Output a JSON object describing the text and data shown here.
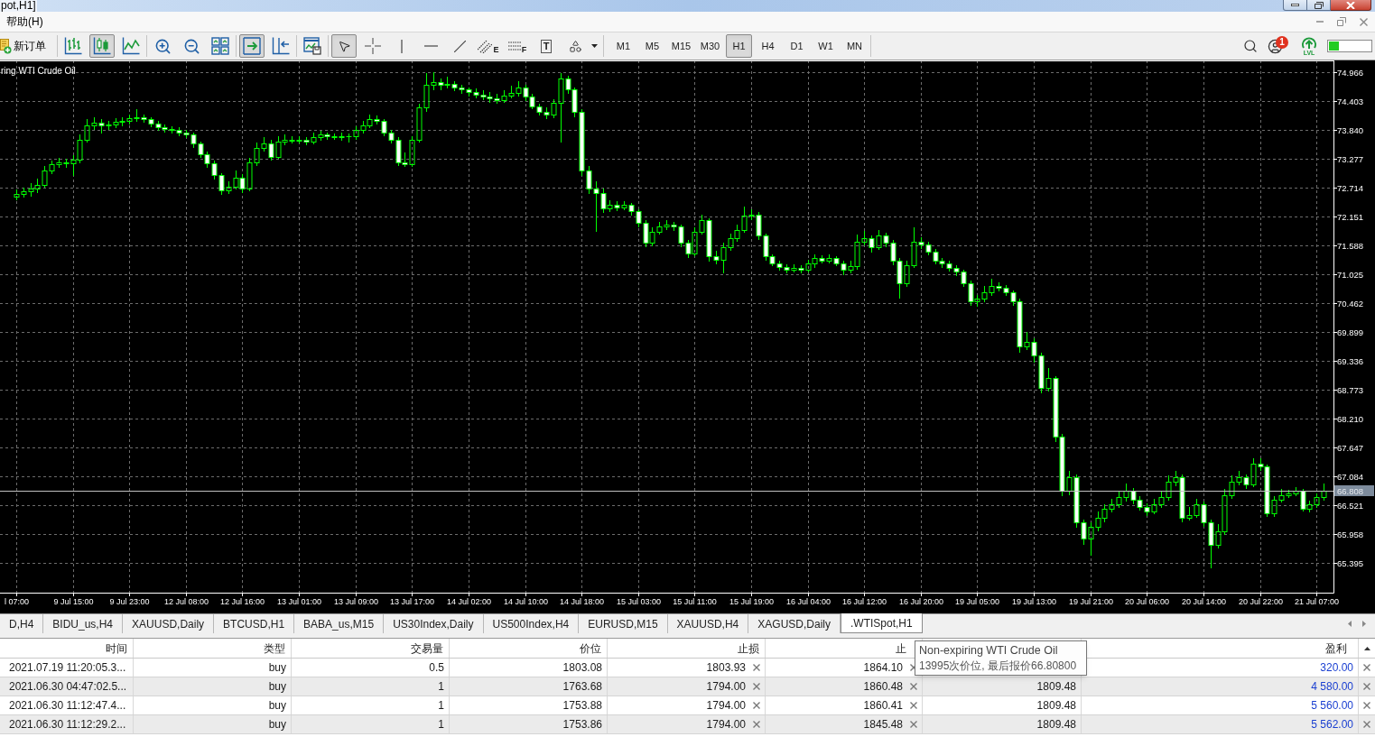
{
  "window": {
    "title": "pot,H1]"
  },
  "menu": {
    "items": [
      "帮助(H)"
    ]
  },
  "toolbar": {
    "new_order": "新订单",
    "chart_modes": [
      {
        "kind": "bars",
        "selected": false
      },
      {
        "kind": "candles",
        "selected": true
      },
      {
        "kind": "line",
        "selected": false
      }
    ],
    "chart_options": [
      {
        "kind": "auto_scroll",
        "on": true
      },
      {
        "kind": "chart_shift",
        "on": false
      }
    ],
    "tools": [
      {
        "kind": "cursor",
        "selected": true
      },
      {
        "kind": "crosshair",
        "selected": false
      },
      {
        "kind": "vertical_line",
        "selected": false
      },
      {
        "kind": "horizontal_line",
        "selected": false
      },
      {
        "kind": "trendline",
        "selected": false
      },
      {
        "kind": "fibonacci",
        "selected": false,
        "letter": "E"
      },
      {
        "kind": "levels",
        "selected": false,
        "letter": "F"
      },
      {
        "kind": "text",
        "selected": false,
        "letter": "T"
      },
      {
        "kind": "shapes",
        "selected": false
      }
    ],
    "timeframes": [
      {
        "label": "M1",
        "selected": false
      },
      {
        "label": "M5",
        "selected": false
      },
      {
        "label": "M15",
        "selected": false
      },
      {
        "label": "M30",
        "selected": false
      },
      {
        "label": "H1",
        "selected": true
      },
      {
        "label": "H4",
        "selected": false
      },
      {
        "label": "D1",
        "selected": false
      },
      {
        "label": "W1",
        "selected": false
      },
      {
        "label": "MN",
        "selected": false
      }
    ],
    "notifications": "1",
    "level_label": "LVL"
  },
  "chart": {
    "chart_data": [
      {
        "type": "candlestick",
        "title": "ring WTI Crude Oil",
        "color": "#00ff00",
        "grid": true,
        "ylim": [
          64.82,
          75.2
        ],
        "yticks": [
          {
            "value": 74.966,
            "label": "74.966"
          },
          {
            "value": 74.403,
            "label": "74.403"
          },
          {
            "value": 73.84,
            "label": "73.840"
          },
          {
            "value": 73.277,
            "label": "73.277"
          },
          {
            "value": 72.714,
            "label": "72.714"
          },
          {
            "value": 72.151,
            "label": "72.151"
          },
          {
            "value": 71.588,
            "label": "71.588"
          },
          {
            "value": 71.025,
            "label": "71.025"
          },
          {
            "value": 70.462,
            "label": "70.462"
          },
          {
            "value": 69.899,
            "label": "69.899"
          },
          {
            "value": 69.336,
            "label": "69.336"
          },
          {
            "value": 68.773,
            "label": "68.773"
          },
          {
            "value": 68.21,
            "label": "68.210"
          },
          {
            "value": 67.647,
            "label": "67.647"
          },
          {
            "value": 67.084,
            "label": "67.084"
          },
          {
            "value": 66.521,
            "label": "66.521"
          },
          {
            "value": 65.958,
            "label": "65.958"
          },
          {
            "value": 65.395,
            "label": "65.395"
          }
        ],
        "ref_lines": [
          {
            "axis": "y",
            "value": 66.808,
            "label": "66.808",
            "color": "#c0c0c0"
          }
        ],
        "categories": [
          "l 07:00",
          null,
          null,
          null,
          null,
          null,
          null,
          null,
          "9 Jul 15:00",
          null,
          null,
          null,
          null,
          null,
          null,
          null,
          "9 Jul 23:00",
          null,
          null,
          null,
          null,
          null,
          null,
          null,
          "12 Jul 08:00",
          null,
          null,
          null,
          null,
          null,
          null,
          null,
          "12 Jul 16:00",
          null,
          null,
          null,
          null,
          null,
          null,
          null,
          "13 Jul 01:00",
          null,
          null,
          null,
          null,
          null,
          null,
          null,
          "13 Jul 09:00",
          null,
          null,
          null,
          null,
          null,
          null,
          null,
          "13 Jul 17:00",
          null,
          null,
          null,
          null,
          null,
          null,
          null,
          "14 Jul 02:00",
          null,
          null,
          null,
          null,
          null,
          null,
          null,
          "14 Jul 10:00",
          null,
          null,
          null,
          null,
          null,
          null,
          null,
          "14 Jul 18:00",
          null,
          null,
          null,
          null,
          null,
          null,
          null,
          "15 Jul 03:00",
          null,
          null,
          null,
          null,
          null,
          null,
          null,
          "15 Jul 11:00",
          null,
          null,
          null,
          null,
          null,
          null,
          null,
          "15 Jul 19:00",
          null,
          null,
          null,
          null,
          null,
          null,
          null,
          "16 Jul 04:00",
          null,
          null,
          null,
          null,
          null,
          null,
          null,
          "16 Jul 12:00",
          null,
          null,
          null,
          null,
          null,
          null,
          null,
          "16 Jul 20:00",
          null,
          null,
          null,
          null,
          null,
          null,
          null,
          "19 Jul 05:00",
          null,
          null,
          null,
          null,
          null,
          null,
          null,
          "19 Jul 13:00",
          null,
          null,
          null,
          null,
          null,
          null,
          null,
          "19 Jul 21:00",
          null,
          null,
          null,
          null,
          null,
          null,
          null,
          "20 Jul 06:00",
          null,
          null,
          null,
          null,
          null,
          null,
          null,
          "20 Jul 14:00",
          null,
          null,
          null,
          null,
          null,
          null,
          null,
          "20 Jul 22:00",
          null,
          null,
          null,
          null,
          null,
          null,
          null,
          "21 Jul 07:00",
          null
        ],
        "ohlc": [
          [
            72.55,
            72.68,
            72.48,
            72.6
          ],
          [
            72.6,
            72.72,
            72.52,
            72.65
          ],
          [
            72.65,
            72.8,
            72.55,
            72.7
          ],
          [
            72.7,
            72.9,
            72.62,
            72.78
          ],
          [
            72.78,
            73.15,
            72.72,
            73.05
          ],
          [
            73.05,
            73.25,
            72.98,
            73.17
          ],
          [
            73.17,
            73.3,
            73.1,
            73.22
          ],
          [
            73.22,
            73.28,
            73.1,
            73.19
          ],
          [
            73.19,
            73.35,
            72.95,
            73.26
          ],
          [
            73.26,
            73.75,
            73.2,
            73.66
          ],
          [
            73.66,
            74.05,
            73.6,
            73.93
          ],
          [
            73.93,
            74.1,
            73.85,
            73.98
          ],
          [
            73.98,
            74.05,
            73.78,
            73.93
          ],
          [
            73.93,
            74.02,
            73.85,
            73.95
          ],
          [
            73.95,
            74.08,
            73.88,
            74.0
          ],
          [
            74.0,
            74.1,
            73.92,
            74.02
          ],
          [
            74.02,
            74.15,
            73.95,
            74.07
          ],
          [
            74.07,
            74.25,
            74.0,
            74.1
          ],
          [
            74.1,
            74.15,
            73.98,
            74.05
          ],
          [
            74.05,
            74.1,
            73.9,
            73.96
          ],
          [
            73.96,
            74.02,
            73.82,
            73.89
          ],
          [
            73.89,
            73.95,
            73.8,
            73.86
          ],
          [
            73.86,
            73.92,
            73.78,
            73.84
          ],
          [
            73.84,
            73.9,
            73.72,
            73.79
          ],
          [
            73.79,
            73.85,
            73.68,
            73.75
          ],
          [
            73.75,
            73.8,
            73.5,
            73.58
          ],
          [
            73.58,
            73.62,
            73.3,
            73.37
          ],
          [
            73.37,
            73.42,
            73.1,
            73.19
          ],
          [
            73.19,
            73.25,
            72.88,
            72.96
          ],
          [
            72.96,
            73.0,
            72.58,
            72.66
          ],
          [
            72.66,
            72.85,
            72.6,
            72.73
          ],
          [
            72.73,
            73.05,
            72.68,
            72.91
          ],
          [
            72.91,
            72.98,
            72.62,
            72.7
          ],
          [
            72.7,
            73.3,
            72.65,
            73.22
          ],
          [
            73.22,
            73.6,
            73.15,
            73.49
          ],
          [
            73.49,
            73.7,
            73.42,
            73.58
          ],
          [
            73.58,
            73.65,
            73.25,
            73.31
          ],
          [
            73.31,
            73.72,
            73.28,
            73.61
          ],
          [
            73.61,
            73.75,
            73.55,
            73.66
          ],
          [
            73.66,
            73.72,
            73.58,
            73.63
          ],
          [
            73.63,
            73.72,
            73.58,
            73.66
          ],
          [
            73.66,
            73.7,
            73.55,
            73.61
          ],
          [
            73.61,
            73.8,
            73.56,
            73.7
          ],
          [
            73.7,
            73.82,
            73.64,
            73.75
          ],
          [
            73.75,
            73.8,
            73.66,
            73.72
          ],
          [
            73.72,
            73.78,
            73.65,
            73.7
          ],
          [
            73.7,
            73.8,
            73.64,
            73.73
          ],
          [
            73.73,
            73.78,
            73.6,
            73.72
          ],
          [
            73.72,
            73.92,
            73.66,
            73.84
          ],
          [
            73.84,
            74.02,
            73.78,
            73.93
          ],
          [
            73.93,
            74.15,
            73.88,
            74.05
          ],
          [
            74.05,
            74.12,
            73.95,
            74.02
          ],
          [
            74.02,
            74.06,
            73.72,
            73.79
          ],
          [
            73.79,
            73.84,
            73.58,
            73.66
          ],
          [
            73.66,
            73.7,
            73.15,
            73.22
          ],
          [
            73.22,
            73.4,
            73.12,
            73.17
          ],
          [
            73.17,
            73.72,
            73.12,
            73.66
          ],
          [
            73.66,
            74.35,
            73.6,
            74.28
          ],
          [
            74.28,
            74.95,
            74.2,
            74.72
          ],
          [
            74.72,
            74.98,
            74.62,
            74.77
          ],
          [
            74.77,
            74.85,
            74.62,
            74.72
          ],
          [
            74.72,
            74.88,
            74.66,
            74.75
          ],
          [
            74.75,
            74.8,
            74.6,
            74.68
          ],
          [
            74.68,
            74.72,
            74.55,
            74.63
          ],
          [
            74.63,
            74.68,
            74.5,
            74.58
          ],
          [
            74.58,
            74.66,
            74.46,
            74.54
          ],
          [
            74.54,
            74.62,
            74.42,
            74.49
          ],
          [
            74.49,
            74.58,
            74.38,
            74.46
          ],
          [
            74.46,
            74.55,
            74.36,
            74.42
          ],
          [
            74.42,
            74.62,
            74.38,
            74.51
          ],
          [
            74.51,
            74.7,
            74.46,
            74.56
          ],
          [
            74.56,
            74.8,
            74.5,
            74.67
          ],
          [
            74.67,
            74.72,
            74.4,
            74.49
          ],
          [
            74.49,
            74.55,
            74.25,
            74.31
          ],
          [
            74.31,
            74.36,
            74.12,
            74.19
          ],
          [
            74.19,
            74.28,
            74.05,
            74.14
          ],
          [
            74.14,
            74.45,
            74.08,
            74.37
          ],
          [
            74.37,
            74.95,
            73.6,
            74.84
          ],
          [
            74.84,
            74.9,
            74.55,
            74.63
          ],
          [
            74.63,
            74.68,
            74.1,
            74.19
          ],
          [
            74.19,
            74.25,
            72.95,
            73.05
          ],
          [
            73.05,
            73.15,
            72.6,
            72.7
          ],
          [
            72.7,
            72.85,
            71.85,
            72.61
          ],
          [
            72.61,
            72.7,
            72.22,
            72.31
          ],
          [
            72.31,
            72.48,
            72.25,
            72.38
          ],
          [
            72.38,
            72.45,
            72.26,
            72.34
          ],
          [
            72.34,
            72.46,
            72.28,
            72.38
          ],
          [
            72.38,
            72.42,
            72.18,
            72.26
          ],
          [
            72.26,
            72.3,
            71.95,
            72.03
          ],
          [
            72.03,
            72.08,
            71.55,
            71.64
          ],
          [
            71.64,
            71.95,
            71.58,
            71.85
          ],
          [
            71.85,
            72.05,
            71.8,
            71.96
          ],
          [
            71.96,
            72.08,
            71.9,
            71.99
          ],
          [
            71.99,
            72.05,
            71.88,
            71.96
          ],
          [
            71.96,
            72.0,
            71.55,
            71.64
          ],
          [
            71.64,
            71.7,
            71.35,
            71.43
          ],
          [
            71.43,
            71.95,
            71.38,
            71.85
          ],
          [
            71.85,
            72.2,
            71.8,
            72.08
          ],
          [
            72.08,
            72.12,
            71.28,
            71.38
          ],
          [
            71.38,
            71.48,
            71.22,
            71.32
          ],
          [
            71.32,
            71.65,
            71.05,
            71.55
          ],
          [
            71.55,
            71.82,
            71.48,
            71.73
          ],
          [
            71.73,
            72.0,
            71.66,
            71.9
          ],
          [
            71.9,
            72.35,
            71.84,
            72.17
          ],
          [
            72.17,
            72.3,
            72.08,
            72.2
          ],
          [
            72.2,
            72.25,
            71.7,
            71.78
          ],
          [
            71.78,
            71.82,
            71.3,
            71.38
          ],
          [
            71.38,
            71.42,
            71.18,
            71.25
          ],
          [
            71.25,
            71.3,
            71.1,
            71.17
          ],
          [
            71.17,
            71.22,
            71.05,
            71.11
          ],
          [
            71.11,
            71.22,
            71.06,
            71.15
          ],
          [
            71.15,
            71.2,
            71.04,
            71.11
          ],
          [
            71.11,
            71.32,
            71.06,
            71.25
          ],
          [
            71.25,
            71.42,
            71.15,
            71.34
          ],
          [
            71.34,
            71.4,
            71.24,
            71.3
          ],
          [
            71.3,
            71.42,
            71.25,
            71.34
          ],
          [
            71.34,
            71.38,
            71.18,
            71.25
          ],
          [
            71.25,
            71.3,
            71.02,
            71.11
          ],
          [
            71.11,
            71.3,
            71.05,
            71.18
          ],
          [
            71.18,
            71.8,
            71.12,
            71.67
          ],
          [
            71.67,
            71.88,
            71.6,
            71.73
          ],
          [
            71.73,
            71.78,
            71.46,
            71.55
          ],
          [
            71.55,
            71.9,
            71.5,
            71.78
          ],
          [
            71.78,
            71.84,
            71.55,
            71.64
          ],
          [
            71.64,
            71.7,
            71.2,
            71.29
          ],
          [
            71.29,
            71.35,
            70.55,
            70.85
          ],
          [
            70.85,
            71.3,
            70.78,
            71.2
          ],
          [
            71.2,
            71.95,
            71.15,
            71.67
          ],
          [
            71.67,
            71.75,
            71.52,
            71.61
          ],
          [
            71.61,
            71.66,
            71.4,
            71.47
          ],
          [
            71.47,
            71.52,
            71.22,
            71.29
          ],
          [
            71.29,
            71.35,
            71.16,
            71.24
          ],
          [
            71.24,
            71.3,
            71.08,
            71.15
          ],
          [
            71.15,
            71.2,
            71.0,
            71.08
          ],
          [
            71.08,
            71.12,
            70.78,
            70.85
          ],
          [
            70.85,
            70.9,
            70.42,
            70.5
          ],
          [
            70.5,
            70.62,
            70.4,
            70.55
          ],
          [
            70.55,
            70.8,
            70.48,
            70.67
          ],
          [
            70.67,
            70.95,
            70.6,
            70.8
          ],
          [
            70.8,
            70.88,
            70.7,
            70.76
          ],
          [
            70.76,
            70.82,
            70.6,
            70.67
          ],
          [
            70.67,
            70.72,
            70.42,
            70.5
          ],
          [
            70.5,
            70.55,
            69.5,
            69.62
          ],
          [
            69.62,
            69.9,
            69.55,
            69.71
          ],
          [
            69.71,
            69.78,
            69.3,
            69.44
          ],
          [
            69.44,
            69.5,
            68.7,
            68.82
          ],
          [
            68.82,
            69.2,
            68.75,
            69.0
          ],
          [
            69.0,
            69.05,
            67.75,
            67.86
          ],
          [
            67.86,
            67.92,
            66.7,
            66.8
          ],
          [
            66.8,
            67.2,
            66.72,
            67.07
          ],
          [
            67.07,
            67.12,
            66.08,
            66.19
          ],
          [
            66.19,
            66.25,
            65.75,
            65.87
          ],
          [
            65.87,
            66.2,
            65.55,
            66.1
          ],
          [
            66.1,
            66.4,
            66.02,
            66.28
          ],
          [
            66.28,
            66.55,
            66.2,
            66.45
          ],
          [
            66.45,
            66.65,
            66.38,
            66.54
          ],
          [
            66.54,
            66.8,
            66.48,
            66.68
          ],
          [
            66.68,
            66.95,
            66.6,
            66.8
          ],
          [
            66.8,
            66.86,
            66.55,
            66.63
          ],
          [
            66.63,
            66.7,
            66.42,
            66.5
          ],
          [
            66.5,
            66.56,
            66.32,
            66.4
          ],
          [
            66.4,
            66.65,
            66.35,
            66.54
          ],
          [
            66.54,
            66.8,
            66.48,
            66.68
          ],
          [
            66.68,
            67.1,
            66.62,
            66.98
          ],
          [
            66.98,
            67.2,
            66.9,
            67.07
          ],
          [
            67.07,
            67.12,
            66.2,
            66.28
          ],
          [
            66.28,
            66.5,
            66.22,
            66.33
          ],
          [
            66.33,
            66.65,
            66.28,
            66.54
          ],
          [
            66.54,
            66.6,
            66.1,
            66.19
          ],
          [
            66.19,
            66.25,
            65.3,
            65.75
          ],
          [
            65.75,
            66.15,
            65.68,
            66.01
          ],
          [
            66.01,
            66.85,
            65.95,
            66.72
          ],
          [
            66.72,
            67.1,
            66.65,
            66.98
          ],
          [
            66.98,
            67.2,
            66.92,
            67.07
          ],
          [
            67.07,
            67.12,
            66.85,
            66.93
          ],
          [
            66.93,
            67.45,
            66.88,
            67.33
          ],
          [
            67.33,
            67.45,
            67.2,
            67.28
          ],
          [
            67.28,
            67.32,
            66.3,
            66.36
          ],
          [
            66.36,
            66.7,
            66.3,
            66.63
          ],
          [
            66.63,
            66.85,
            66.58,
            66.72
          ],
          [
            66.72,
            66.82,
            66.66,
            66.75
          ],
          [
            66.75,
            66.88,
            66.7,
            66.8
          ],
          [
            66.8,
            66.85,
            66.4,
            66.45
          ],
          [
            66.45,
            66.62,
            66.38,
            66.54
          ],
          [
            66.54,
            66.75,
            66.48,
            66.68
          ],
          [
            66.68,
            66.95,
            66.62,
            66.81
          ]
        ]
      }
    ]
  },
  "chart_tabs": [
    {
      "label": "D,H4",
      "selected": false
    },
    {
      "label": "BIDU_us,H4",
      "selected": false
    },
    {
      "label": "XAUUSD,Daily",
      "selected": false
    },
    {
      "label": "BTCUSD,H1",
      "selected": false
    },
    {
      "label": "BABA_us,M15",
      "selected": false
    },
    {
      "label": "US30Index,Daily",
      "selected": false
    },
    {
      "label": "US500Index,H4",
      "selected": false
    },
    {
      "label": "EURUSD,M15",
      "selected": false
    },
    {
      "label": "XAUUSD,H4",
      "selected": false
    },
    {
      "label": "XAGUSD,Daily",
      "selected": false
    },
    {
      "label": ".WTISpot,H1",
      "selected": true
    }
  ],
  "trade_table": {
    "headers": {
      "time": "时间",
      "type": "类型",
      "volume": "交易量",
      "price": "价位",
      "stop_loss": "止损",
      "take_profit": "止",
      "profit": "盈利"
    },
    "rows": [
      {
        "time": "2021.07.19 11:20:05.3...",
        "type": "buy",
        "volume": "0.5",
        "price": "1803.08",
        "stop_loss": "1803.93",
        "take_profit": "1864.10",
        "profit": "320.00"
      },
      {
        "time": "2021.06.30 04:47:02.5...",
        "type": "buy",
        "volume": "1",
        "price": "1763.68",
        "stop_loss": "1794.00",
        "take_profit": "1860.48",
        "column_7": "1809.48",
        "profit": "4 580.00"
      },
      {
        "time": "2021.06.30 11:12:47.4...",
        "type": "buy",
        "volume": "1",
        "price": "1753.88",
        "stop_loss": "1794.00",
        "take_profit": "1860.41",
        "column_7": "1809.48",
        "profit": "5 560.00"
      },
      {
        "time": "2021.06.30 11:12:29.2...",
        "type": "buy",
        "volume": "1",
        "price": "1753.86",
        "stop_loss": "1794.00",
        "take_profit": "1845.48",
        "column_7": "1809.48",
        "profit": "5 562.00"
      }
    ]
  },
  "tooltip": {
    "title": "Non-expiring WTI Crude Oil",
    "detail": "13995次价位, 最后报价66.80800"
  }
}
